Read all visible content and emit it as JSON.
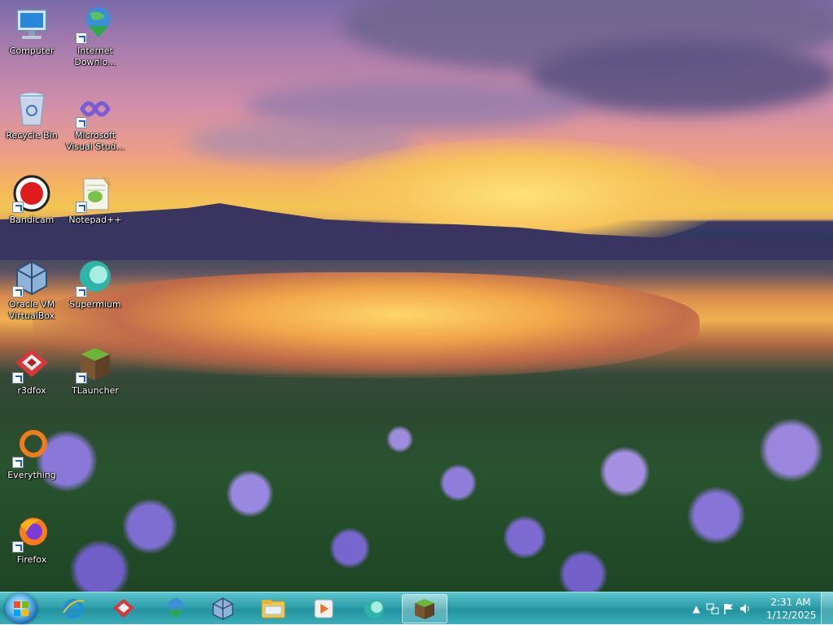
{
  "desktop": {
    "icons": [
      {
        "label": "Computer"
      },
      {
        "label": "Internet Downlo..."
      },
      {
        "label": "Recycle Bin"
      },
      {
        "label": "Microsoft Visual Stud..."
      },
      {
        "label": "Bandicam"
      },
      {
        "label": "Notepad++"
      },
      {
        "label": "Oracle VM VirtualBox"
      },
      {
        "label": "Supermium"
      },
      {
        "label": "r3dfox"
      },
      {
        "label": "TLauncher"
      },
      {
        "label": "Everything"
      },
      {
        "label": "Firefox"
      }
    ]
  },
  "taskbar": {
    "pinned": [
      "internet-explorer-icon",
      "r3dfox-icon",
      "internet-download-manager-icon",
      "virtualbox-icon",
      "file-explorer-icon",
      "media-player-icon",
      "supermium-icon",
      "tlauncher-icon"
    ],
    "active_index": 7,
    "accent": "#2ea0ab"
  },
  "tray": {
    "time": "2:31 AM",
    "date": "1/12/2025"
  }
}
